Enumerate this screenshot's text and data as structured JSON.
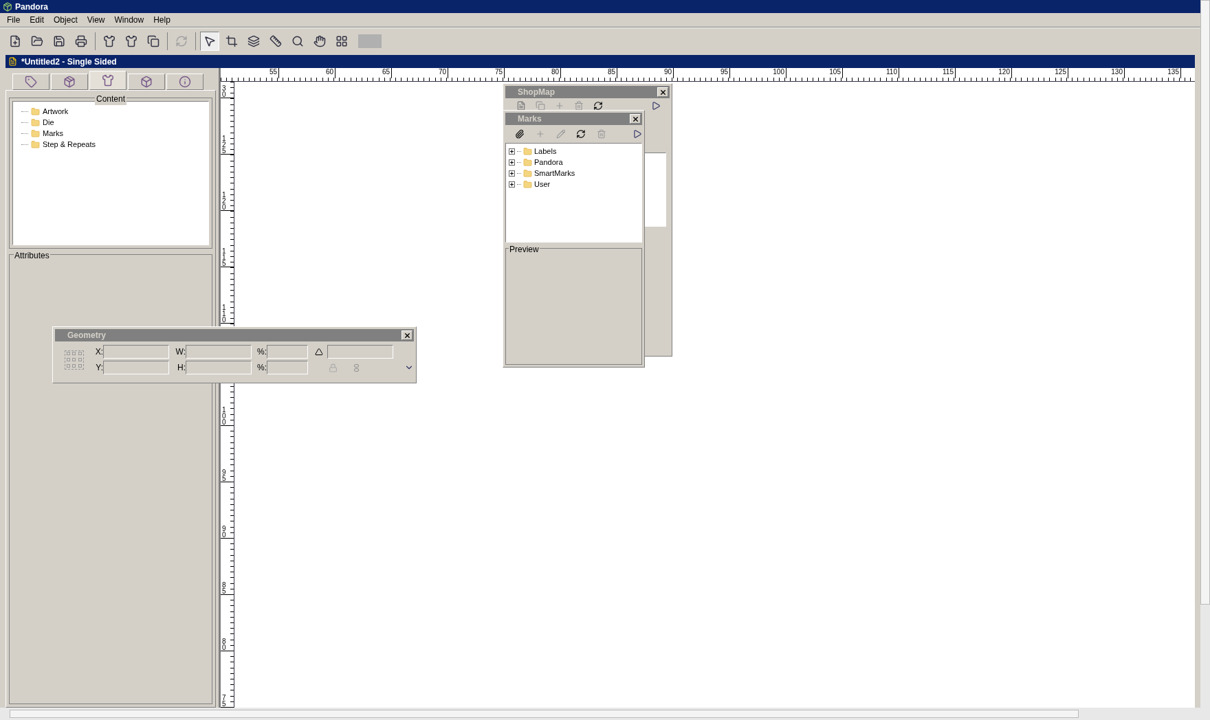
{
  "window": {
    "title": "Pandora"
  },
  "menu": [
    "File",
    "Edit",
    "Object",
    "View",
    "Window",
    "Help"
  ],
  "tools": [
    {
      "selected": true
    },
    {
      "selected": false
    },
    {
      "selected": false
    },
    {
      "selected": false
    },
    {
      "selected": false
    },
    {
      "selected": false
    },
    {
      "selected": false
    }
  ],
  "document": {
    "title": "*Untitled2 - Single Sided"
  },
  "side_tabs": [
    {
      "selected": false
    },
    {
      "selected": false
    },
    {
      "selected": true
    },
    {
      "selected": false
    },
    {
      "selected": false
    }
  ],
  "content": {
    "title": "Content",
    "tree": [
      {
        "label": "Artwork"
      },
      {
        "label": "Die"
      },
      {
        "label": "Marks"
      },
      {
        "label": "Step & Repeats"
      }
    ]
  },
  "attributes": {
    "title": "Attributes"
  },
  "ruler": {
    "horizontal": [
      "55",
      "60",
      "65",
      "70",
      "75",
      "80",
      "85",
      "90",
      "95",
      "100",
      "105",
      "110",
      "115",
      "120",
      "125",
      "130",
      "135"
    ],
    "vertical_upper": [
      "30",
      "125",
      "120",
      "115",
      "110"
    ],
    "vertical_lower": [
      "100",
      "95",
      "90",
      "85",
      "80",
      "75"
    ]
  },
  "shopmap": {
    "title": "ShopMap"
  },
  "marks": {
    "title": "Marks",
    "tree": [
      {
        "label": "Labels",
        "expanded": false
      },
      {
        "label": "Pandora",
        "expanded": false
      },
      {
        "label": "SmartMarks",
        "expanded": false
      },
      {
        "label": "User",
        "expanded": false
      }
    ],
    "preview_title": "Preview"
  },
  "geometry": {
    "title": "Geometry",
    "row_1": [
      "X:",
      "W:",
      "%:"
    ],
    "row_2": [
      "Y:",
      "H:",
      "%:"
    ]
  }
}
